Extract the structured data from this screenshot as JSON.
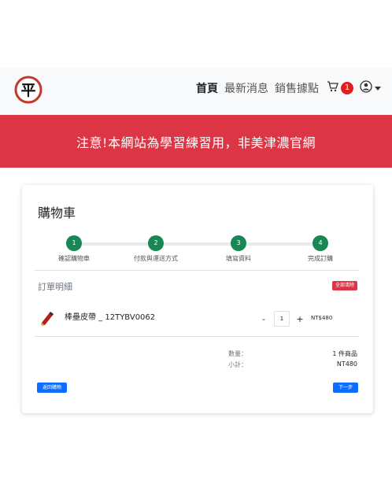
{
  "navbar": {
    "logo_text": "平",
    "links": [
      "首頁",
      "最新消息",
      "銷售據點"
    ],
    "cart_count": "1"
  },
  "banner": {
    "text": "注意!本網站為學習練習用，非美津濃官網"
  },
  "cart": {
    "title": "購物車",
    "steps": [
      {
        "num": "1",
        "label": "確認購物車"
      },
      {
        "num": "2",
        "label": "付款與運送方式"
      },
      {
        "num": "3",
        "label": "填寫資料"
      },
      {
        "num": "4",
        "label": "完成訂購"
      }
    ],
    "order_title": "訂單明細",
    "clear_all": "全部清除",
    "item": {
      "name": "棒壘皮帶 _ 12TYBV0062",
      "minus": "-",
      "qty": "1",
      "plus": "+",
      "price": "NT$480"
    },
    "summary": {
      "qty_label": "數量：",
      "qty_value": "1 件商品",
      "subtotal_label": "小計：",
      "subtotal_value": "NT480"
    },
    "back_button": "返回購物",
    "next_button": "下一步"
  },
  "colors": {
    "banner": "#dc3545",
    "step": "#198754",
    "primary": "#0d6efd",
    "badge": "#e01e1e"
  }
}
